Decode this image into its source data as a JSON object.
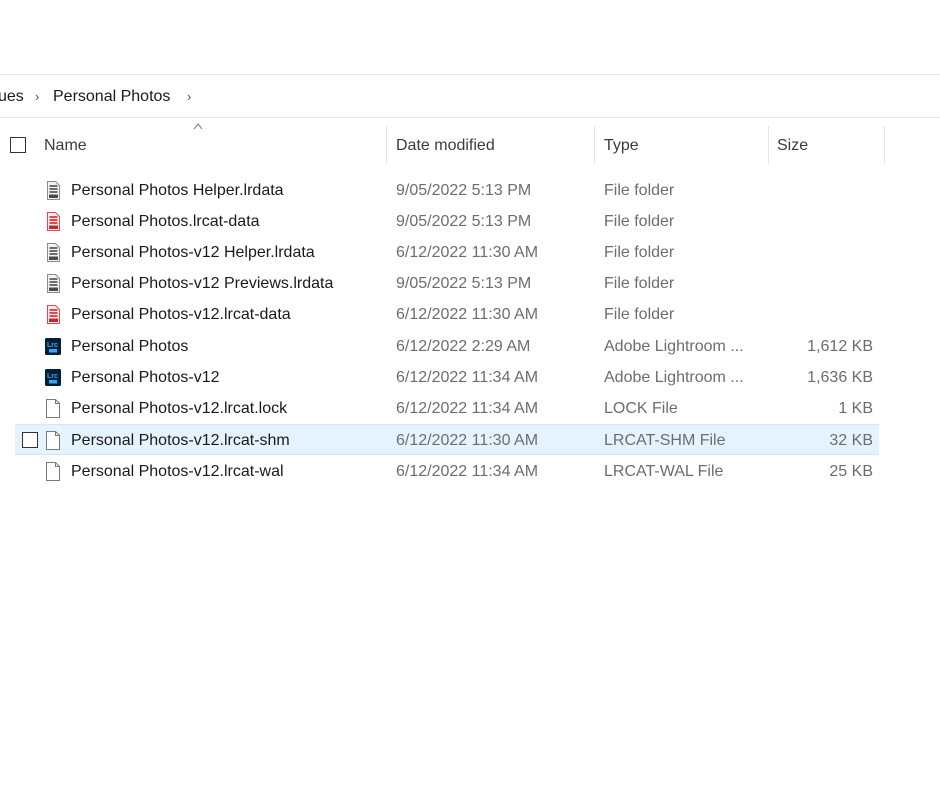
{
  "breadcrumb": {
    "previous": "ues",
    "current": "Personal Photos",
    "separator": "›"
  },
  "columns": {
    "name": "Name",
    "date_modified": "Date modified",
    "type": "Type",
    "size": "Size"
  },
  "files": [
    {
      "name": "Personal Photos Helper.lrdata",
      "date": "9/05/2022 5:13 PM",
      "type": "File folder",
      "size": "",
      "icon": "lrdata-gray-icon"
    },
    {
      "name": "Personal Photos.lrcat-data",
      "date": "9/05/2022 5:13 PM",
      "type": "File folder",
      "size": "",
      "icon": "lrcat-data-red-icon"
    },
    {
      "name": "Personal Photos-v12 Helper.lrdata",
      "date": "6/12/2022 11:30 AM",
      "type": "File folder",
      "size": "",
      "icon": "lrdata-gray-icon"
    },
    {
      "name": "Personal Photos-v12 Previews.lrdata",
      "date": "9/05/2022 5:13 PM",
      "type": "File folder",
      "size": "",
      "icon": "lrdata-gray-icon"
    },
    {
      "name": "Personal Photos-v12.lrcat-data",
      "date": "6/12/2022 11:30 AM",
      "type": "File folder",
      "size": "",
      "icon": "lrcat-data-red-icon"
    },
    {
      "name": "Personal Photos",
      "date": "6/12/2022 2:29 AM",
      "type": "Adobe Lightroom ...",
      "size": "1,612 KB",
      "icon": "lightroom-catalog-icon"
    },
    {
      "name": "Personal Photos-v12",
      "date": "6/12/2022 11:34 AM",
      "type": "Adobe Lightroom ...",
      "size": "1,636 KB",
      "icon": "lightroom-catalog-icon"
    },
    {
      "name": "Personal Photos-v12.lrcat.lock",
      "date": "6/12/2022 11:34 AM",
      "type": "LOCK File",
      "size": "1 KB",
      "icon": "blank-file-icon"
    },
    {
      "name": "Personal Photos-v12.lrcat-shm",
      "date": "6/12/2022 11:30 AM",
      "type": "LRCAT-SHM File",
      "size": "32 KB",
      "icon": "blank-file-icon"
    },
    {
      "name": "Personal Photos-v12.lrcat-wal",
      "date": "6/12/2022 11:34 AM",
      "type": "LRCAT-WAL File",
      "size": "25 KB",
      "icon": "blank-file-icon"
    }
  ],
  "selected_index": 8,
  "colors": {
    "selection_bg": "#e5f3ff",
    "lightroom_blue": "#001e36",
    "lightroom_accent": "#31a8ff",
    "lrcat_red": "#e34850"
  }
}
